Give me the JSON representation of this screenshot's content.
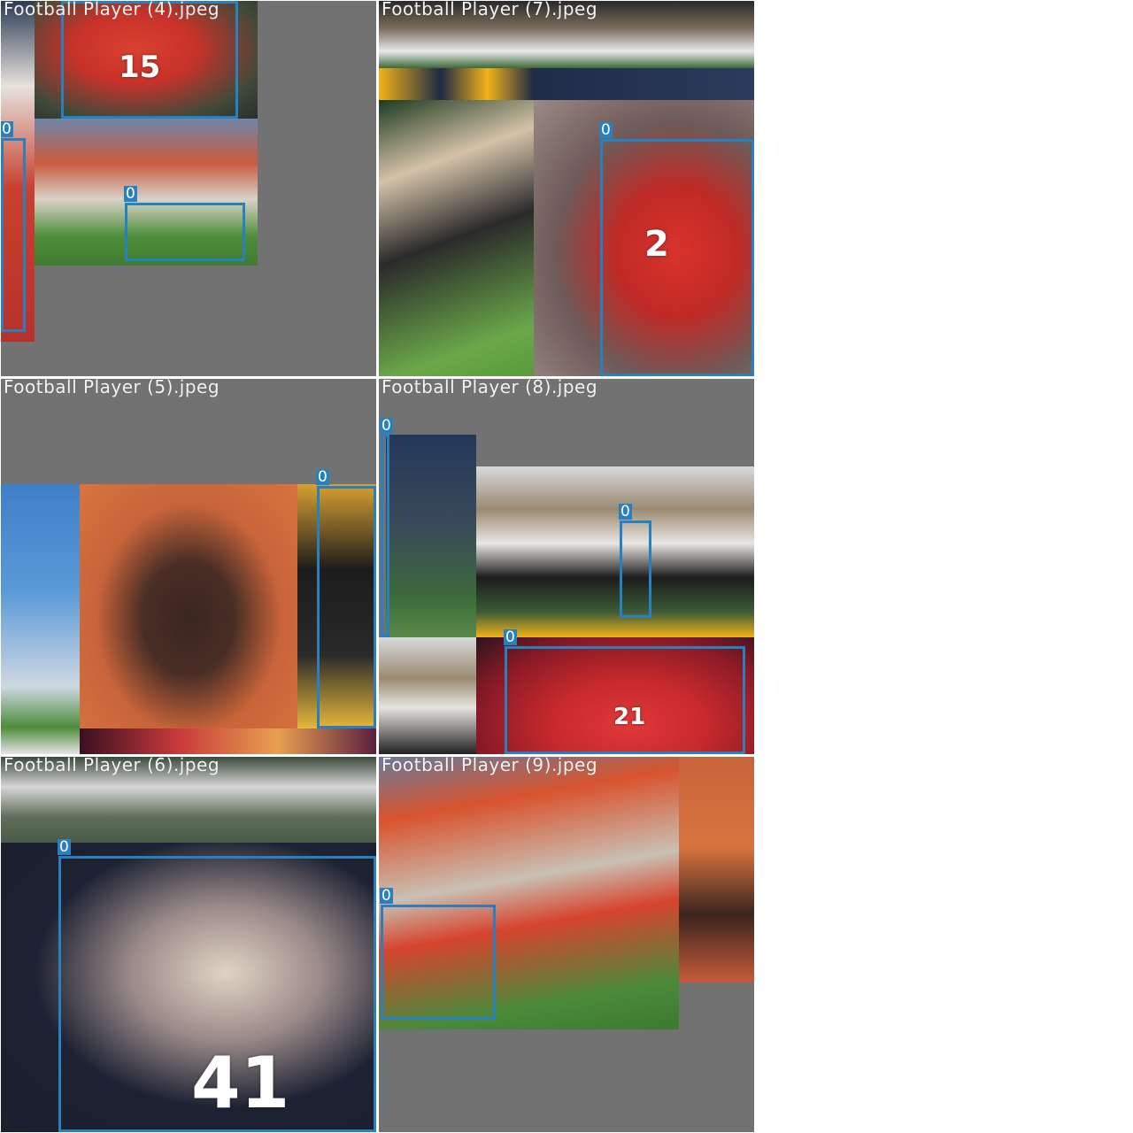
{
  "colors": {
    "tile_background": "#727272",
    "box_color": "#2a7fbf",
    "title_color": "#f4f4f4"
  },
  "tiles": [
    {
      "title": "Football Player (4).jpeg",
      "boxes": [
        {
          "label": "0"
        },
        {
          "label": "0"
        }
      ]
    },
    {
      "title": "Football Player (7).jpeg",
      "boxes": [
        {
          "label": "0"
        }
      ]
    },
    {
      "title": "Football Player (5).jpeg",
      "boxes": [
        {
          "label": "0"
        }
      ]
    },
    {
      "title": "Football Player (8).jpeg",
      "boxes": [
        {
          "label": "0"
        },
        {
          "label": "0"
        },
        {
          "label": "0"
        }
      ]
    },
    {
      "title": "Football Player (6).jpeg",
      "boxes": [
        {
          "label": "0"
        }
      ]
    },
    {
      "title": "Football Player (9).jpeg",
      "boxes": [
        {
          "label": "0"
        }
      ]
    }
  ],
  "jersey_numbers": [
    "15",
    "2",
    "21",
    "41"
  ]
}
